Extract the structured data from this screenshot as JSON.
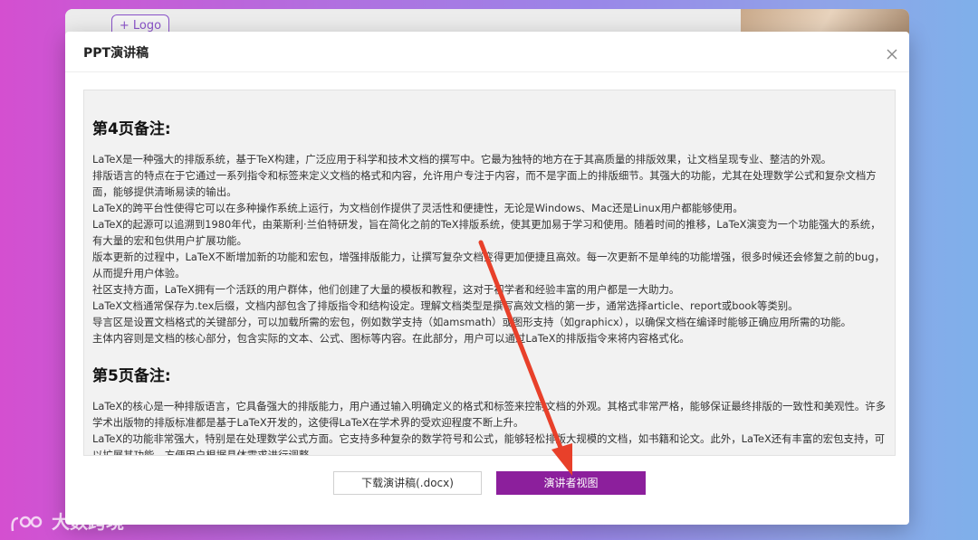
{
  "background": {
    "logo_button_label": "+ Logo"
  },
  "modal": {
    "title": "PPT演讲稿",
    "sections": [
      {
        "heading": "第4页备注:",
        "paragraphs": [
          "LaTeX是一种强大的排版系统，基于TeX构建，广泛应用于科学和技术文档的撰写中。它最为独特的地方在于其高质量的排版效果，让文档呈现专业、整洁的外观。",
          "排版语言的特点在于它通过一系列指令和标签来定义文档的格式和内容，允许用户专注于内容，而不是字面上的排版细节。其强大的功能，尤其在处理数学公式和复杂文档方面，能够提供清晰易读的输出。",
          "LaTeX的跨平台性使得它可以在多种操作系统上运行，为文档创作提供了灵活性和便捷性，无论是Windows、Mac还是Linux用户都能够使用。",
          "LaTeX的起源可以追溯到1980年代，由莱斯利·兰伯特研发，旨在简化之前的TeX排版系统，使其更加易于学习和使用。随着时间的推移，LaTeX演变为一个功能强大的系统，有大量的宏和包供用户扩展功能。",
          "版本更新的过程中，LaTeX不断增加新的功能和宏包，增强排版能力，让撰写复杂文档变得更加便捷且高效。每一次更新不是单纯的功能增强，很多时候还会修复之前的bug，从而提升用户体验。",
          "社区支持方面，LaTeX拥有一个活跃的用户群体，他们创建了大量的模板和教程，这对于初学者和经验丰富的用户都是一大助力。",
          "LaTeX文档通常保存为.tex后缀，文档内部包含了排版指令和结构设定。理解文档类型是撰写高效文档的第一步，通常选择article、report或book等类别。",
          "导言区是设置文档格式的关键部分，可以加载所需的宏包，例如数学支持（如amsmath）或图形支持（如graphicx），以确保文档在编译时能够正确应用所需的功能。",
          "主体内容则是文档的核心部分，包含实际的文本、公式、图标等内容。在此部分，用户可以通过LaTeX的排版指令来将内容格式化。"
        ]
      },
      {
        "heading": "第5页备注:",
        "paragraphs": [
          "LaTeX的核心是一种排版语言，它具备强大的排版能力，用户通过输入明确定义的格式和标签来控制文档的外观。其格式非常严格，能够保证最终排版的一致性和美观性。许多学术出版物的排版标准都是基于LaTeX开发的，这使得LaTeX在学术界的受欢迎程度不断上升。",
          "LaTeX的功能非常强大，特别是在处理数学公式方面。它支持多种复杂的数学符号和公式，能够轻松排版大规模的文档，如书籍和论文。此外，LaTeX还有丰富的宏包支持，可以扩展其功能，方便用户根据具体需求进行调整。"
        ]
      }
    ],
    "download_button_label": "下载演讲稿(.docx)",
    "presenter_button_label": "演讲者视图"
  },
  "watermark": {
    "text": "大数跨境"
  },
  "colors": {
    "accent": "#8c1f9c",
    "annotation_arrow": "#e8402a"
  }
}
